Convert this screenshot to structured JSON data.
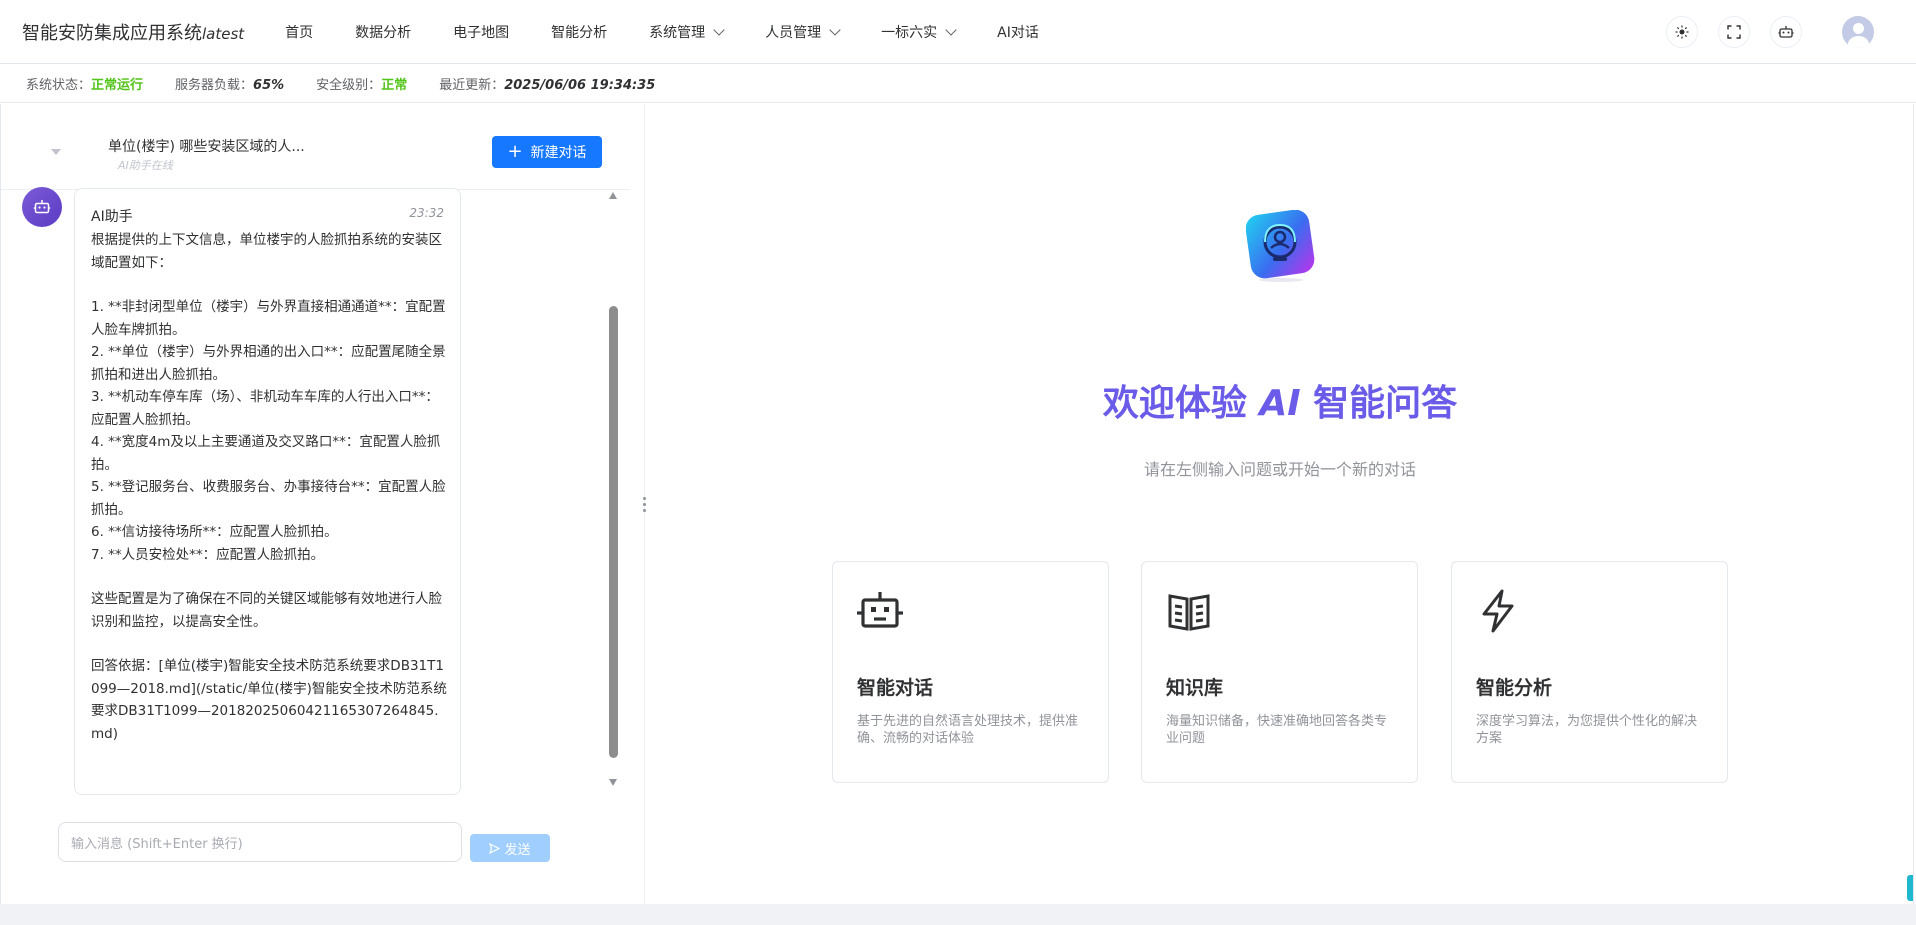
{
  "header": {
    "app_title": "智能安防集成应用系统",
    "app_version": "latest",
    "nav": [
      {
        "label": "首页",
        "dropdown": false
      },
      {
        "label": "数据分析",
        "dropdown": false
      },
      {
        "label": "电子地图",
        "dropdown": false
      },
      {
        "label": "智能分析",
        "dropdown": false
      },
      {
        "label": "系统管理",
        "dropdown": true
      },
      {
        "label": "人员管理",
        "dropdown": true
      },
      {
        "label": "一标六实",
        "dropdown": true
      },
      {
        "label": "AI对话",
        "dropdown": false
      }
    ],
    "actions": [
      "theme-toggle-icon",
      "fullscreen-icon",
      "robot-icon",
      "avatar"
    ]
  },
  "status": {
    "system_label": "系统状态：",
    "system_value": "正常运行",
    "load_label": "服务器负载：",
    "load_value": "65%",
    "security_label": "安全级别：",
    "security_value": "正常",
    "updated_label": "最近更新：",
    "updated_value": "2025/06/06 19:34:35",
    "colors": {
      "ok": "#52c41a"
    }
  },
  "conversation": {
    "title": "单位(楼宇) 哪些安装区域的人...",
    "subtitle": "AI助手在线",
    "new_button": "新建对话"
  },
  "message": {
    "sender": "AI助手",
    "time": "23:32",
    "paragraphs": [
      "根据提供的上下文信息，单位楼宇的人脸抓拍系统的安装区域配置如下：",
      "1. **非封闭型单位（楼宇）与外界直接相通通道**：宜配置人脸车牌抓拍。\n2. **单位（楼宇）与外界相通的出入口**：应配置尾随全景抓拍和进出人脸抓拍。\n3. **机动车停车库（场）、非机动车车库的人行出入口**：应配置人脸抓拍。\n4. **宽度4m及以上主要通道及交叉路口**：宜配置人脸抓拍。\n5. **登记服务台、收费服务台、办事接待台**：宜配置人脸抓拍。\n6. **信访接待场所**：应配置人脸抓拍。\n7. **人员安检处**：应配置人脸抓拍。",
      "这些配置是为了确保在不同的关键区域能够有效地进行人脸识别和监控，以提高安全性。",
      "回答依据：[单位(楼宇)智能安全技术防范系统要求DB31T1099—2018.md](/static/单位(楼宇)智能安全技术防范系统要求DB31T1099—20182025060421165307264845.md)"
    ]
  },
  "composer": {
    "placeholder": "输入消息 (Shift+Enter 换行)",
    "send_label": "发送"
  },
  "welcome": {
    "title_pre": "欢迎体验 ",
    "title_ai": "AI",
    "title_post": " 智能问答",
    "subtitle": "请在左侧输入问题或开始一个新的对话",
    "accent": "#6a5be8",
    "cards": [
      {
        "icon": "robot-icon",
        "title": "智能对话",
        "desc": "基于先进的自然语言处理技术，提供准确、流畅的对话体验"
      },
      {
        "icon": "book-icon",
        "title": "知识库",
        "desc": "海量知识储备，快速准确地回答各类专业问题"
      },
      {
        "icon": "lightning-icon",
        "title": "智能分析",
        "desc": "深度学习算法，为您提供个性化的解决方案"
      }
    ]
  }
}
